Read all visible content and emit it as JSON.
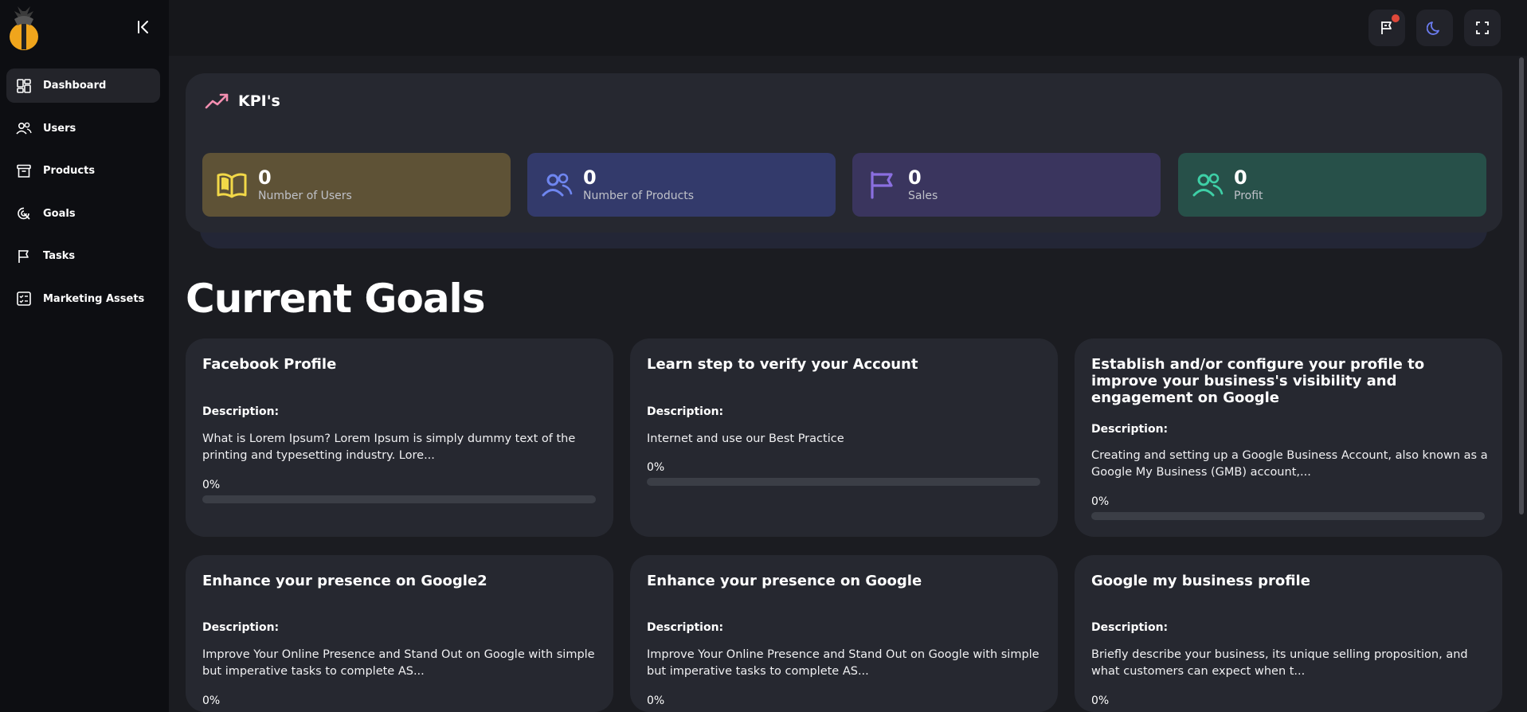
{
  "sidebar": {
    "items": [
      {
        "label": "Dashboard",
        "icon": "dashboard-icon",
        "active": true
      },
      {
        "label": "Users",
        "icon": "users-icon"
      },
      {
        "label": "Products",
        "icon": "archive-box-icon"
      },
      {
        "label": "Goals",
        "icon": "target-icon"
      },
      {
        "label": "Tasks",
        "icon": "flag-icon"
      },
      {
        "label": "Marketing Assets",
        "icon": "checklist-icon"
      }
    ]
  },
  "topbar": {
    "buttons": [
      "flag-notification-icon",
      "moon-icon",
      "fullscreen-icon"
    ]
  },
  "kpi": {
    "title": "KPI's",
    "cards": [
      {
        "value": "0",
        "label": "Number of Users",
        "icon": "open-book-icon",
        "bg": "#5e5236",
        "icon_color": "#f2d848"
      },
      {
        "value": "0",
        "label": "Number of Products",
        "icon": "users-icon",
        "bg": "#333a6b",
        "icon_color": "#6f86f0"
      },
      {
        "value": "0",
        "label": "Sales",
        "icon": "flag-icon",
        "bg": "#3a355e",
        "icon_color": "#8a6fe0"
      },
      {
        "value": "0",
        "label": "Profit",
        "icon": "users-icon",
        "bg": "#275049",
        "icon_color": "#3ecfa6"
      }
    ]
  },
  "goals": {
    "title": "Current Goals",
    "cards": [
      {
        "title": "Facebook Profile",
        "desc_label": "Description:",
        "desc": "What is Lorem Ipsum? Lorem Ipsum is simply dummy text of the printing and typesetting industry. Lore...",
        "progress_text": "0%",
        "progress": 0
      },
      {
        "title": "Learn step to verify your Account",
        "desc_label": "Description:",
        "desc": "Internet and use our Best Practice",
        "progress_text": "0%",
        "progress": 0
      },
      {
        "title": "Establish and/or configure your profile to improve your business's visibility and engagement on Google",
        "desc_label": "Description:",
        "desc": "Creating and setting up a Google Business Account, also known as a Google My Business (GMB) account,...",
        "progress_text": "0%",
        "progress": 0
      },
      {
        "title": "Enhance your presence on Google2",
        "desc_label": "Description:",
        "desc": "Improve Your Online Presence and Stand Out on Google with simple but imperative tasks to complete AS...",
        "progress_text": "0%",
        "progress": 0
      },
      {
        "title": "Enhance your presence on Google",
        "desc_label": "Description:",
        "desc": "Improve Your Online Presence and Stand Out on Google with simple but imperative tasks to complete AS...",
        "progress_text": "0%",
        "progress": 0
      },
      {
        "title": "Google my business profile",
        "desc_label": "Description:",
        "desc": "Briefly describe your business, its unique selling proposition, and what customers can expect when t...",
        "progress_text": "0%",
        "progress": 0
      }
    ]
  },
  "colors": {
    "accent": "#6b7cf0",
    "kpi_trend": "#f48fb1",
    "notification": "#e0483a"
  }
}
